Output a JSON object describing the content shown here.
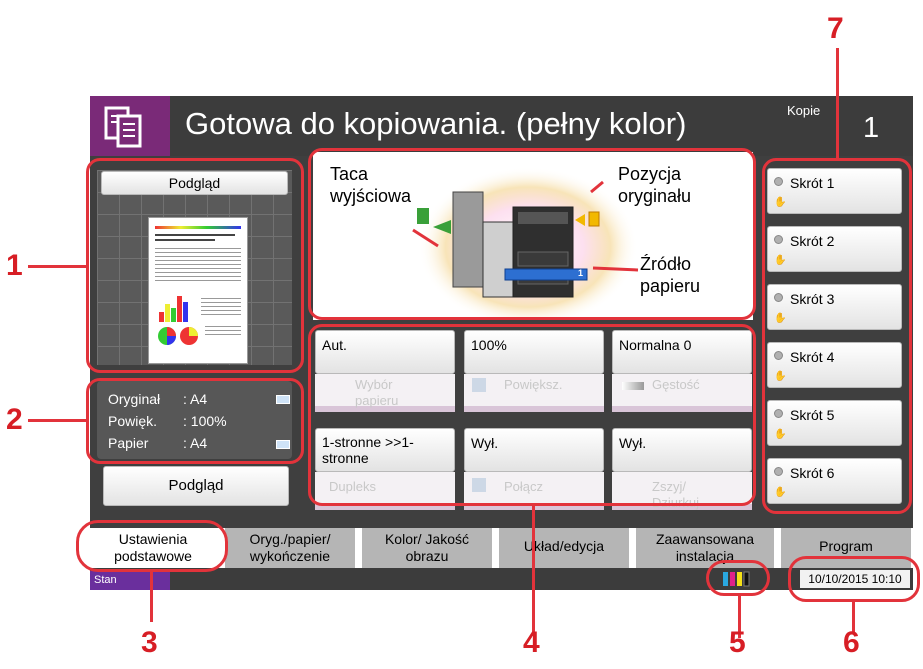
{
  "header": {
    "title": "Gotowa do kopiowania. (pełny kolor)",
    "copies_label": "Kopie",
    "copies_value": "1"
  },
  "preview": {
    "heading": "Podgląd",
    "button_label": "Podgląd",
    "info": [
      {
        "label": "Oryginał",
        "value": ": A4"
      },
      {
        "label": "Powięk.",
        "value": ": 100%"
      },
      {
        "label": "Papier",
        "value": ": A4"
      }
    ]
  },
  "device": {
    "output_tray": "Taca wyjściowa",
    "original_position": "Pozycja oryginału",
    "paper_source": "Źródło papieru",
    "cassette_number": "1"
  },
  "functions": [
    {
      "value": "Aut.",
      "name": "Wybór papieru"
    },
    {
      "value": "100%",
      "name": "Powiększ."
    },
    {
      "value": "Normalna 0",
      "name": "Gęstość"
    },
    {
      "value": "1-stronne >>1-stronne",
      "name": "Dupleks"
    },
    {
      "value": "Wył.",
      "name": "Połącz"
    },
    {
      "value": "Wył.",
      "name": "Zszyj/ Dziurkuj"
    }
  ],
  "shortcuts": [
    "Skrót 1",
    "Skrót 2",
    "Skrót 3",
    "Skrót 4",
    "Skrót 5",
    "Skrót 6"
  ],
  "tabs": [
    "Ustawienia podstawowe",
    "Oryg./papier/ wykończenie",
    "Kolor/ Jakość obrazu",
    "Układ/edycja",
    "Zaawansowana instalacja",
    "Program"
  ],
  "status": {
    "label": "Stan",
    "datetime": "10/10/2015  10:10"
  },
  "callouts": [
    "1",
    "2",
    "3",
    "4",
    "5",
    "6",
    "7"
  ],
  "colors": {
    "accent_purple": "#7a2a78",
    "callout_red": "#d71e25",
    "status_purple": "#6a2f9d"
  }
}
